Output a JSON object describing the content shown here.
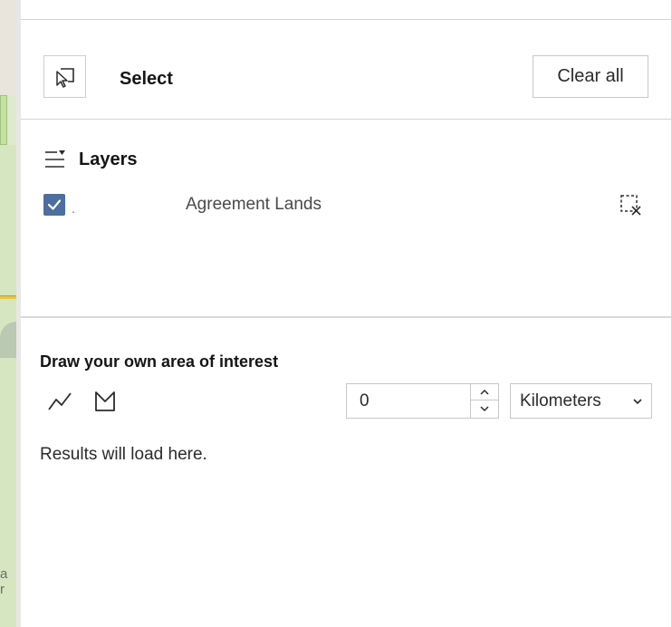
{
  "map": {
    "partial_label": "a r"
  },
  "select": {
    "title": "Select",
    "clear_all_label": "Clear all",
    "select_icon": "select-pointer-icon"
  },
  "layers": {
    "title": "Layers",
    "icon": "layers-list-icon",
    "items": [
      {
        "prefix": ".",
        "name": "Agreement Lands",
        "checked": true
      }
    ],
    "clear_selection_icon": "clear-selection-icon"
  },
  "draw": {
    "title": "Draw your own area of interest",
    "tools": [
      "polyline-icon",
      "polygon-icon"
    ],
    "buffer_value": "0",
    "unit": "Kilometers"
  },
  "results": {
    "text": "Results will load here."
  },
  "colors": {
    "checkbox": "#4c6ea0",
    "map_green": "#d6e6c1",
    "road": "#e8c25a"
  }
}
